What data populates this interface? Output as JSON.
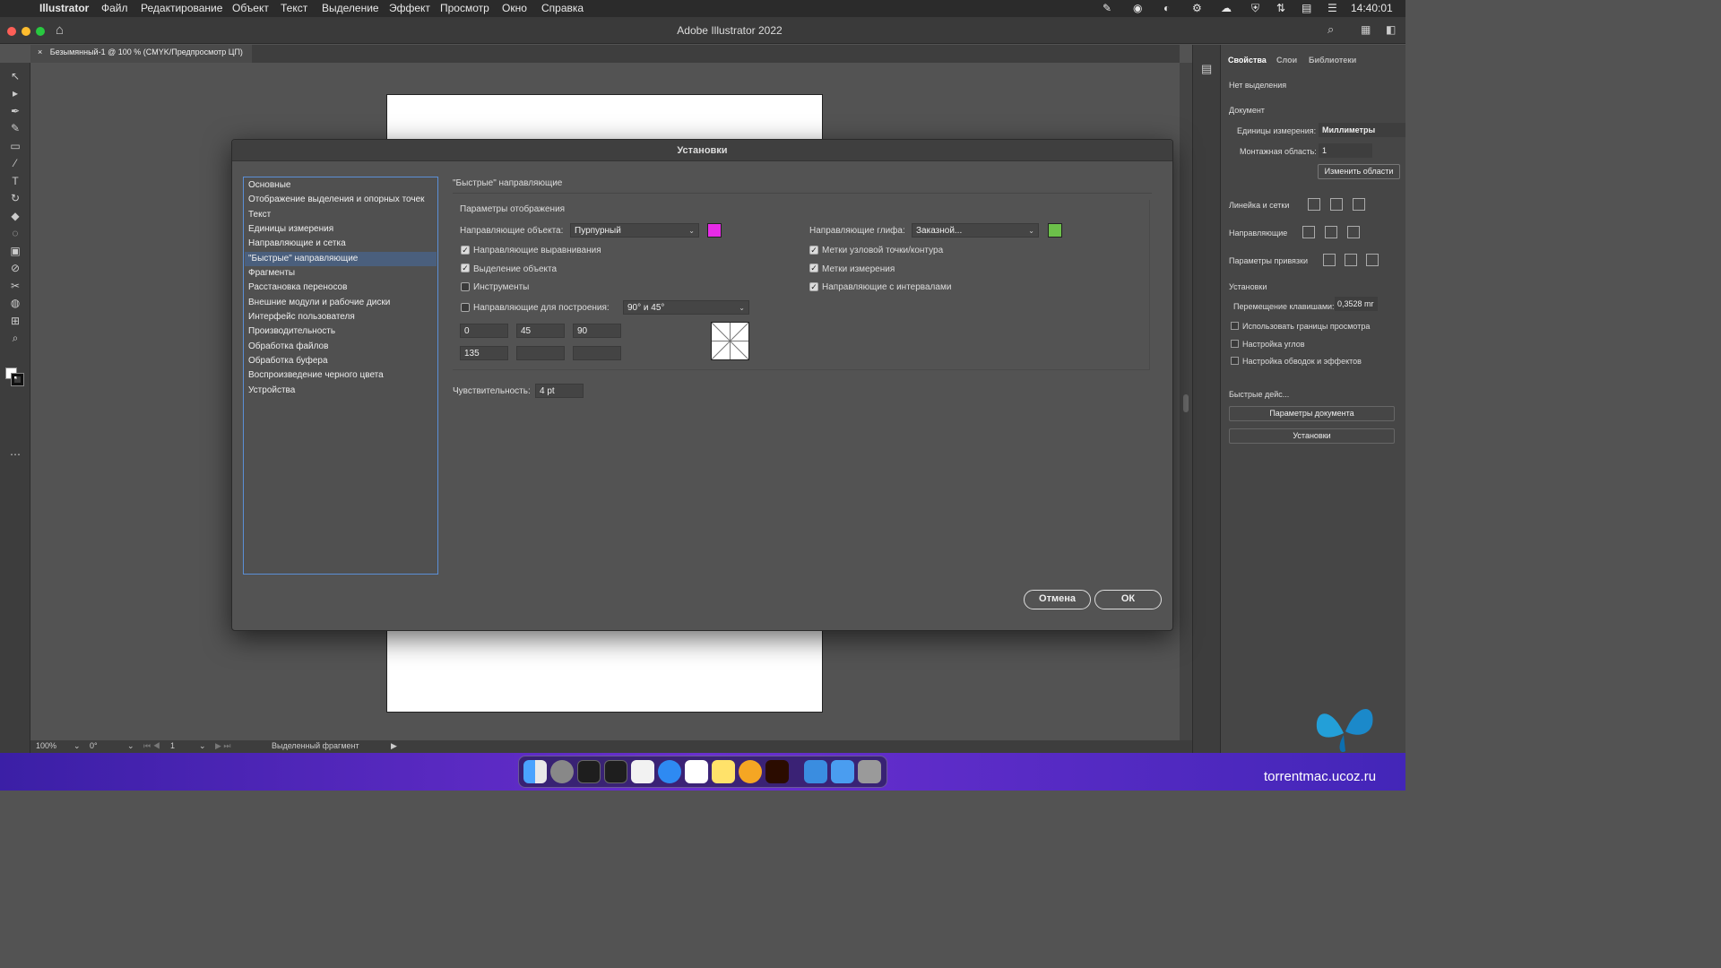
{
  "menubar": {
    "app": "Illustrator",
    "items": [
      "Файл",
      "Редактирование",
      "Объект",
      "Текст",
      "Выделение",
      "Эффект",
      "Просмотр",
      "Окно",
      "Справка"
    ],
    "time": "14:40:01"
  },
  "window": {
    "title": "Adobe Illustrator 2022"
  },
  "doc_tab": {
    "close": "×",
    "label": "Безымянный-1 @ 100 % (CMYK/Предпросмотр ЦП)"
  },
  "status": {
    "zoom": "100%",
    "rotate": "0°",
    "artboard": "1",
    "tool": "Выделенный фрагмент"
  },
  "panel": {
    "tabs": [
      "Свойства",
      "Слои",
      "Библиотеки"
    ],
    "no_selection": "Нет выделения",
    "document": "Документ",
    "units_label": "Единицы измерения:",
    "units_value": "Миллиметры",
    "artboard_label": "Монтажная область:",
    "artboard_value": "1",
    "edit_artboards": "Изменить области",
    "rulers_grids": "Линейка и сетки",
    "guides": "Направляющие",
    "snap_options": "Параметры привязки",
    "preferences": "Установки",
    "keyboard_inc_label": "Перемещение клавишами:",
    "keyboard_inc_value": "0,3528 mr",
    "chk_preview_bounds": "Использовать границы просмотра",
    "chk_scale_corners": "Настройка углов",
    "chk_scale_strokes": "Настройка обводок и эффектов",
    "quick_actions": "Быстрые дейс...",
    "doc_setup_button": "Параметры документа",
    "prefs_button": "Установки"
  },
  "dialog": {
    "title": "Установки",
    "categories": [
      "Основные",
      "Отображение выделения и опорных точек",
      "Текст",
      "Единицы измерения",
      "Направляющие и сетка",
      "\"Быстрые\" направляющие",
      "Фрагменты",
      "Расстановка переносов",
      "Внешние модули и рабочие диски",
      "Интерфейс пользователя",
      "Производительность",
      "Обработка файлов",
      "Обработка буфера",
      "Воспроизведение черного цвета",
      "Устройства"
    ],
    "selected_index": 5,
    "section_title": "\"Быстрые\" направляющие",
    "group_title": "Параметры отображения",
    "object_guides_label": "Направляющие объекта:",
    "object_guides_value": "Пурпурный",
    "object_guides_color": "#e82be8",
    "glyph_guides_label": "Направляющие глифа:",
    "glyph_guides_value": "Заказной...",
    "glyph_guides_color": "#6cc04a",
    "checks_left": [
      {
        "label": "Направляющие выравнивания",
        "checked": true
      },
      {
        "label": "Выделение объекта",
        "checked": true
      },
      {
        "label": "Инструменты",
        "checked": false
      }
    ],
    "checks_right": [
      {
        "label": "Метки узловой точки/контура",
        "checked": true
      },
      {
        "label": "Метки измерения",
        "checked": true
      },
      {
        "label": "Направляющие с интервалами",
        "checked": true
      }
    ],
    "construction_label": "Направляющие для построения:",
    "construction_checked": false,
    "construction_value": "90° и 45°",
    "angles": [
      "0",
      "45",
      "90",
      "135",
      "",
      ""
    ],
    "tolerance_label": "Чувствительность:",
    "tolerance_value": "4 pt",
    "cancel": "Отмена",
    "ok": "ОК"
  },
  "watermark": "torrentmac.ucoz.ru"
}
